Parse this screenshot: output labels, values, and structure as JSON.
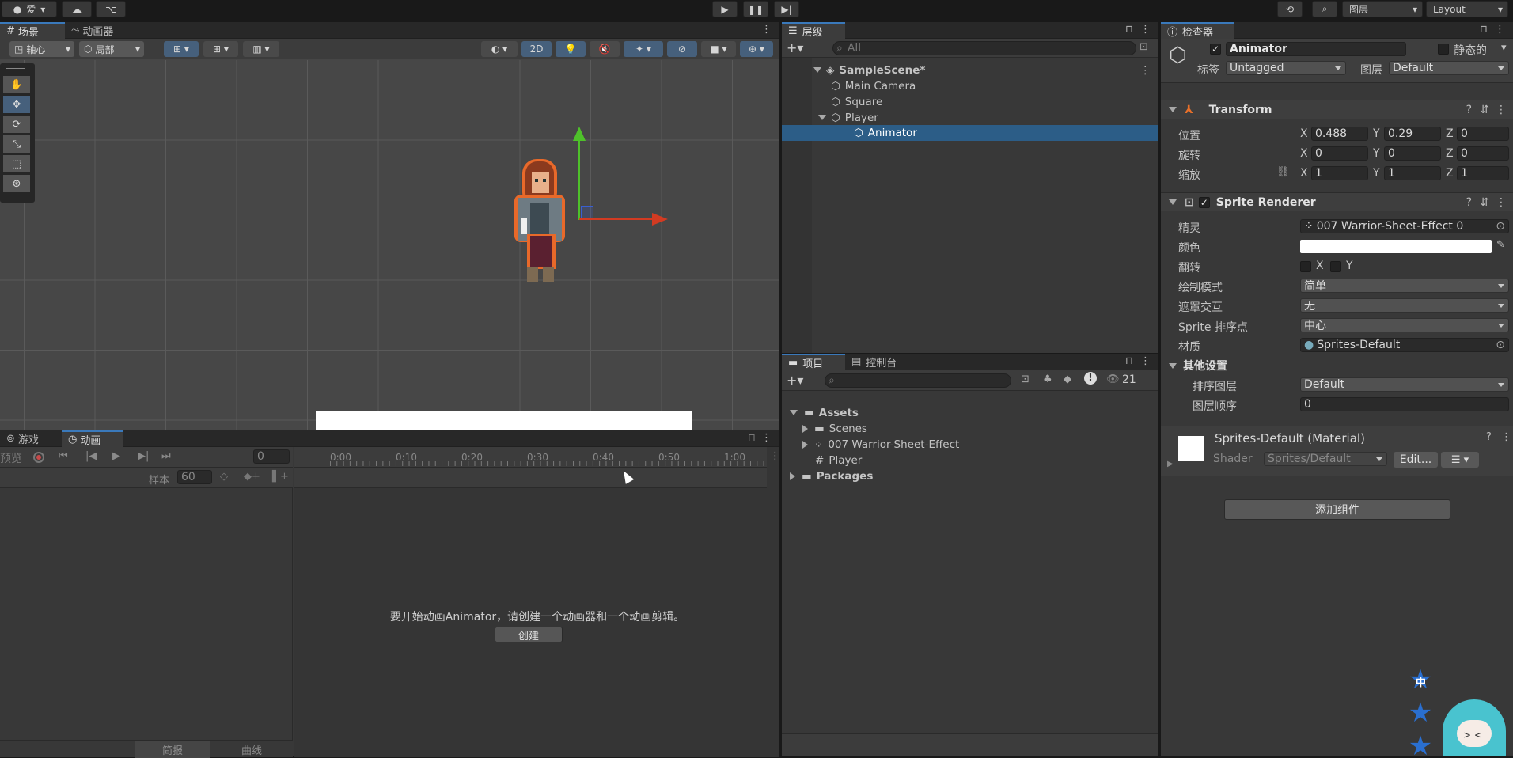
{
  "topbar": {
    "account": "爱",
    "layers": "图层",
    "layout": "Layout"
  },
  "scene": {
    "tabs": {
      "scene": "场景",
      "animator": "动画器"
    },
    "pivot": "轴心",
    "local": "局部",
    "mode2d": "2D"
  },
  "anim": {
    "tabs": {
      "game": "游戏",
      "animation": "动画"
    },
    "preview": "预览",
    "frame": "0",
    "samples_label": "样本",
    "samples": "60",
    "ticks": [
      "0:00",
      "0:10",
      "0:20",
      "0:30",
      "0:40",
      "0:50",
      "1:00"
    ],
    "message": "要开始动画Animator，请创建一个动画器和一个动画剪辑。",
    "create": "创建",
    "dopesheet": "简报",
    "curves": "曲线"
  },
  "hierarchy": {
    "tab": "层级",
    "search": "All",
    "items": [
      {
        "label": "SampleScene*",
        "depth": 0
      },
      {
        "label": "Main Camera",
        "depth": 1
      },
      {
        "label": "Square",
        "depth": 1
      },
      {
        "label": "Player",
        "depth": 1
      },
      {
        "label": "Animator",
        "depth": 2
      }
    ]
  },
  "project": {
    "tabs": {
      "project": "项目",
      "console": "控制台"
    },
    "count": "21",
    "items": [
      {
        "label": "Assets"
      },
      {
        "label": "Scenes"
      },
      {
        "label": "007 Warrior-Sheet-Effect"
      },
      {
        "label": "Player"
      },
      {
        "label": "Packages"
      }
    ]
  },
  "inspector": {
    "tab": "检查器",
    "name": "Animator",
    "static": "静态的",
    "tag_label": "标签",
    "tag": "Untagged",
    "layer_label": "图层",
    "layer": "Default",
    "transform": {
      "title": "Transform",
      "position": "位置",
      "rotation": "旋转",
      "scale": "缩放",
      "pos": {
        "x": "0.488",
        "y": "0.29",
        "z": "0"
      },
      "rot": {
        "x": "0",
        "y": "0",
        "z": "0"
      },
      "scl": {
        "x": "1",
        "y": "1",
        "z": "1"
      }
    },
    "sprite": {
      "title": "Sprite Renderer",
      "sprite_label": "精灵",
      "sprite": "007 Warrior-Sheet-Effect 0",
      "color_label": "颜色",
      "flip_label": "翻转",
      "draw_mode_label": "绘制模式",
      "draw_mode": "简单",
      "mask_label": "遮罩交互",
      "mask": "无",
      "sort_point_label": "Sprite 排序点",
      "sort_point": "中心",
      "material_label": "材质",
      "material": "Sprites-Default",
      "other": "其他设置",
      "sort_layer_label": "排序图层",
      "sort_layer": "Default",
      "order_label": "图层顺序",
      "order": "0"
    },
    "mat": {
      "title": "Sprites-Default (Material)",
      "shader_label": "Shader",
      "shader": "Sprites/Default",
      "edit": "Edit..."
    },
    "add_component": "添加组件"
  },
  "mascot": {
    "char": "中"
  },
  "axis": {
    "x": "X",
    "y": "Y",
    "z": "Z"
  }
}
